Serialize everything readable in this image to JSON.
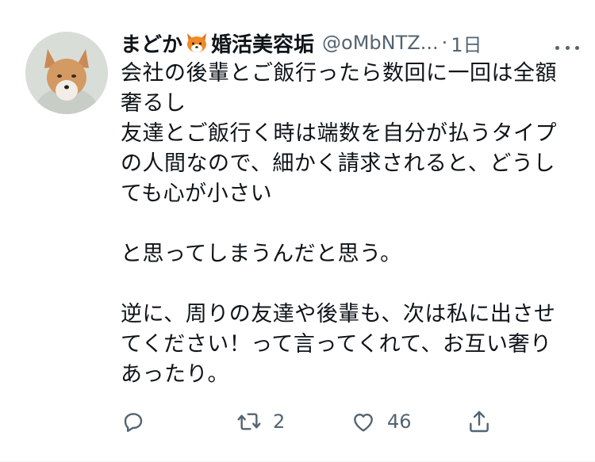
{
  "tweet": {
    "author": {
      "name": "まどか",
      "name_suffix": "婚活美容垢",
      "handle": "@oMbNTZ...",
      "time": "1日"
    },
    "text_lines": [
      "会社の後輩とご飯行ったら数回に一回は全額",
      "奢るし",
      "友達とご飯行く時は端数を自分が払うタイプ",
      "の人間なので、細かく請求されると、どうし",
      "ても心が小さい",
      "",
      "と思ってしまうんだと思う。",
      "",
      "逆に、周りの友達や後輩も、次は私に出させ",
      "てください！って言ってくれて、お互い奢り",
      "あったり。"
    ],
    "actions": {
      "reply": {
        "icon": "reply-icon",
        "count": ""
      },
      "retweet": {
        "icon": "retweet-icon",
        "count": "2"
      },
      "like": {
        "icon": "heart-icon",
        "count": "46"
      },
      "share": {
        "icon": "share-icon",
        "count": ""
      }
    }
  },
  "colors": {
    "text": "#0f1419",
    "secondary": "#536471"
  }
}
